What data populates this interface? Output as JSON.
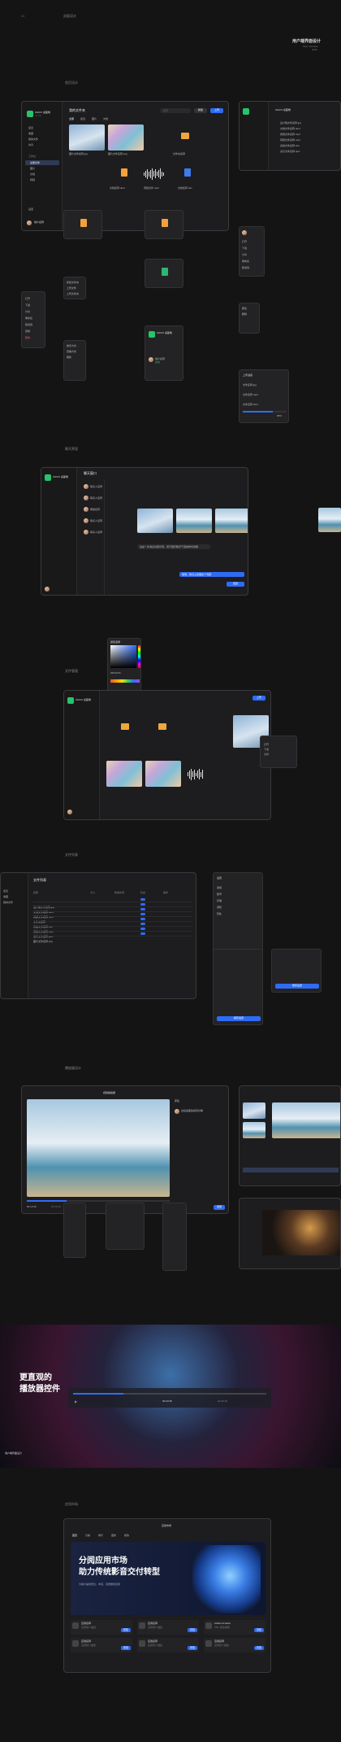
{
  "header": {
    "page_no": "01",
    "cover_label": "封面设计",
    "title": "用户端界面设计",
    "subtitle1": "User Interface",
    "subtitle2": "2023"
  },
  "sections": {
    "s1": "首页设计",
    "s2": "聊天界面",
    "s3": "文件管理",
    "s4": "文件列表",
    "s5": "播放器设计",
    "s6": "应用市场"
  },
  "app": {
    "name": "ZHUXI 桌面端",
    "version": "v1.0.0",
    "search_placeholder": "搜索",
    "user": "用户名称",
    "user_status": "在线"
  },
  "sidebar": {
    "items": [
      "最近",
      "收藏",
      "我的文件",
      "共享",
      "回收站",
      "设置"
    ],
    "groups": [
      "工作台",
      "全部文件",
      "图片",
      "文档",
      "视频"
    ]
  },
  "filegrid": {
    "title": "我的文件夹",
    "tabs": [
      "全部",
      "最近",
      "图片",
      "文档"
    ],
    "new_btn": "新建",
    "upload_btn": "上传",
    "files": [
      {
        "name": "图片文件名称.jpg",
        "meta": "2.4MB"
      },
      {
        "name": "图片文件名称.png",
        "meta": "3.1MB"
      },
      {
        "name": "文件夹名称",
        "meta": "12项"
      },
      {
        "name": "文档名称.docx",
        "meta": "1.2MB"
      },
      {
        "name": "音频文件.mp3",
        "meta": "4.6MB"
      },
      {
        "name": "文档名称.doc",
        "meta": "800KB"
      }
    ]
  },
  "list_window": {
    "title": "ZHUXI 桌面端",
    "rows": [
      "设计稿文件名称.jpg",
      "文档文件名称.docx",
      "视频文件名称.mp4",
      "音频文件名称.mp3",
      "表格文件名称.xlsx",
      "演示文件名称.pptx"
    ]
  },
  "context_menu": {
    "items": [
      "打开",
      "下载",
      "分享",
      "重命名",
      "移动到",
      "复制",
      "删除"
    ]
  },
  "popup_menus": {
    "a": [
      "新建文件夹",
      "上传文件",
      "上传文件夹"
    ],
    "b": [
      "排序方式",
      "查看方式",
      "刷新"
    ],
    "c": [
      "属性",
      "删除"
    ]
  },
  "chat": {
    "title": "聊天窗口",
    "contacts": [
      "联系人名称",
      "联系人名称",
      "群组名称",
      "联系人名称",
      "联系人名称"
    ],
    "message": "这是一条消息内容示例，用于展示聊天气泡的样式效果",
    "reply": "收到，我马上处理这个问题",
    "send_btn": "发送"
  },
  "color_picker": {
    "title": "颜色选择",
    "hex": "#2F6CF6"
  },
  "upload": {
    "title": "上传进度",
    "items": [
      "文件名称.jpg",
      "文件名称.mp4",
      "文件名称.docx"
    ],
    "percent": "68%"
  },
  "table": {
    "title": "文件列表",
    "columns": [
      "名称",
      "大小",
      "修改时间",
      "类型",
      "状态",
      "操作"
    ],
    "rows": [
      "设计稿文件名称.jpg",
      "文档文件名称.docx",
      "视频文件名称.mp4",
      "文件夹名称",
      "表格文件名称.xlsx",
      "音频文件名称.mp3",
      "演示文件名称.pptx",
      "图片文件名称.png"
    ]
  },
  "settings": {
    "title": "设置",
    "items": [
      "通用",
      "账号",
      "存储",
      "通知",
      "隐私"
    ],
    "save_btn": "保存设置"
  },
  "player": {
    "title": "视频播放器",
    "time": "00:12:36",
    "total": "00:45:20",
    "comments_title": "评论",
    "comment": "这段画面拍得真好看",
    "send": "发送"
  },
  "promo": {
    "headline1": "更直观的",
    "headline2": "播放器控件",
    "tag": "用户端界面设计",
    "time": "00:23:45",
    "total": "01:32:10"
  },
  "store": {
    "title": "应用市场",
    "nav": [
      "首页",
      "分类",
      "排行",
      "更新",
      "我的"
    ],
    "hero1": "分阅应用市场",
    "hero2": "助力传统影音交付转型",
    "hero_sub": "为用户提供安全、丰富、高质量的应用",
    "apps": [
      {
        "name": "应用名称",
        "desc": "应用简介描述",
        "btn": "安装"
      },
      {
        "name": "应用名称",
        "desc": "应用简介描述",
        "btn": "安装"
      },
      {
        "name": "Adobe Acrobat",
        "desc": "PDF 阅读编辑",
        "btn": "安装"
      },
      {
        "name": "应用名称",
        "desc": "应用简介描述",
        "btn": "安装"
      },
      {
        "name": "应用名称",
        "desc": "应用简介描述",
        "btn": "安装"
      },
      {
        "name": "应用名称",
        "desc": "应用简介描述",
        "btn": "安装"
      }
    ]
  },
  "colors": {
    "accent": "#2f6cf6",
    "logo": "#27c46b",
    "folder": "#f0a63a"
  }
}
